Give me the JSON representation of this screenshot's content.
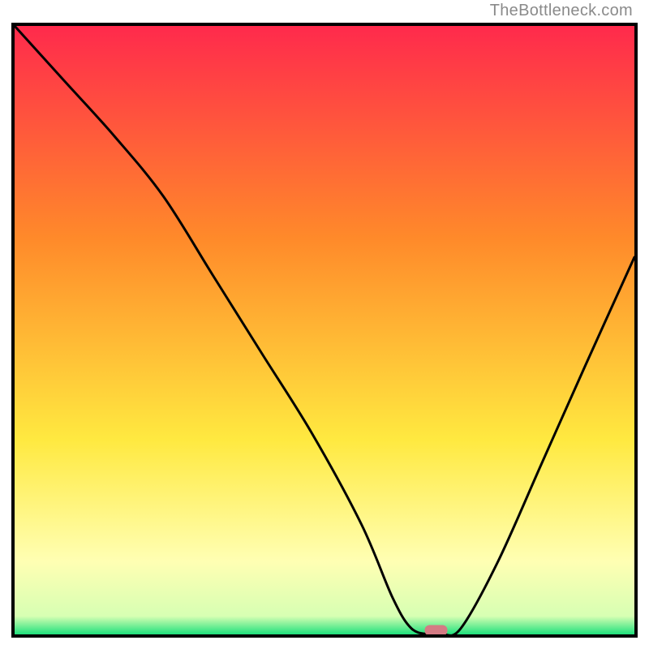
{
  "watermark": "TheBottleneck.com",
  "colors": {
    "top_red": "#ff2a4c",
    "mid_orange": "#ff8a2a",
    "mid_yellow": "#ffe940",
    "pale_yellow": "#ffffb3",
    "green": "#1fe07c",
    "frame": "#000000",
    "curve": "#000000",
    "marker": "#d47b84"
  },
  "chart_data": {
    "type": "line",
    "title": "",
    "xlabel": "",
    "ylabel": "",
    "xlim": [
      0,
      100
    ],
    "ylim": [
      0,
      100
    ],
    "x": [
      0,
      8,
      16,
      24,
      32,
      40,
      48,
      56,
      61,
      64,
      67,
      69,
      72,
      78,
      85,
      92,
      100
    ],
    "values": [
      100,
      91,
      82,
      72,
      59,
      46,
      33,
      18,
      6,
      1,
      0,
      0,
      1,
      12,
      28,
      44,
      62
    ],
    "marker": {
      "x": 68,
      "y": 0.6
    },
    "annotations": []
  }
}
